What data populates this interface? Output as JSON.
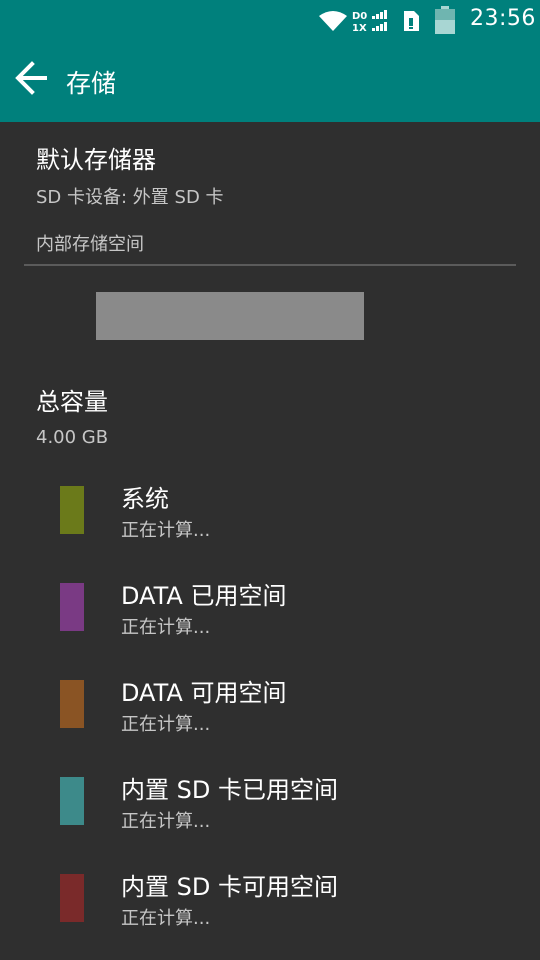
{
  "status_bar": {
    "signal_text_top": "D0",
    "signal_text_bottom": "1X",
    "time": "23:56"
  },
  "app_bar": {
    "title": "存储",
    "back_icon": "arrow-back-icon",
    "background": "#00807c"
  },
  "default_storage": {
    "title": "默认存储器",
    "subtitle": "SD 卡设备: 外置 SD 卡"
  },
  "internal_storage": {
    "section_header": "内部存储空间",
    "total_title": "总容量",
    "total_value": "4.00 GB"
  },
  "usage_items": [
    {
      "label": "系统",
      "status": "正在计算...",
      "color": "#6b7a1a"
    },
    {
      "label": "DATA 已用空间",
      "status": "正在计算...",
      "color": "#7a3a84"
    },
    {
      "label": "DATA 可用空间",
      "status": "正在计算...",
      "color": "#8a5424"
    },
    {
      "label": "内置 SD 卡已用空间",
      "status": "正在计算...",
      "color": "#3d8a8a"
    },
    {
      "label": "内置 SD 卡可用空间",
      "status": "正在计算...",
      "color": "#7a2a2a"
    }
  ]
}
